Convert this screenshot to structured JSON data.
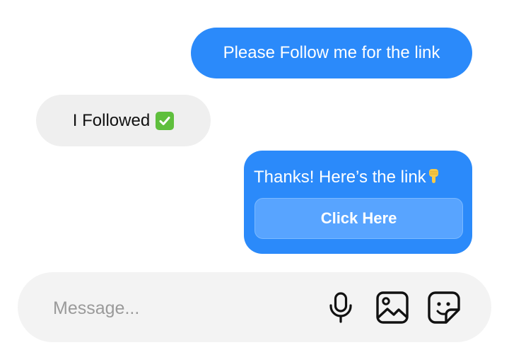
{
  "messages": [
    {
      "direction": "outgoing",
      "text": "Please Follow me for the link"
    },
    {
      "direction": "incoming",
      "text": "I Followed",
      "emoji": "check-mark-button-icon"
    },
    {
      "direction": "outgoing",
      "text": "Thanks! Here’s the link",
      "emoji": "backhand-index-pointing-down-icon",
      "button_label": "Click Here"
    }
  ],
  "composer": {
    "placeholder": "Message...",
    "icons": [
      "microphone-icon",
      "image-icon",
      "sticker-icon"
    ]
  },
  "colors": {
    "outgoing_bubble": "#2b8afa",
    "incoming_bubble": "#efefef",
    "link_button": "#58a4ff",
    "composer_bg": "#f3f3f3"
  }
}
